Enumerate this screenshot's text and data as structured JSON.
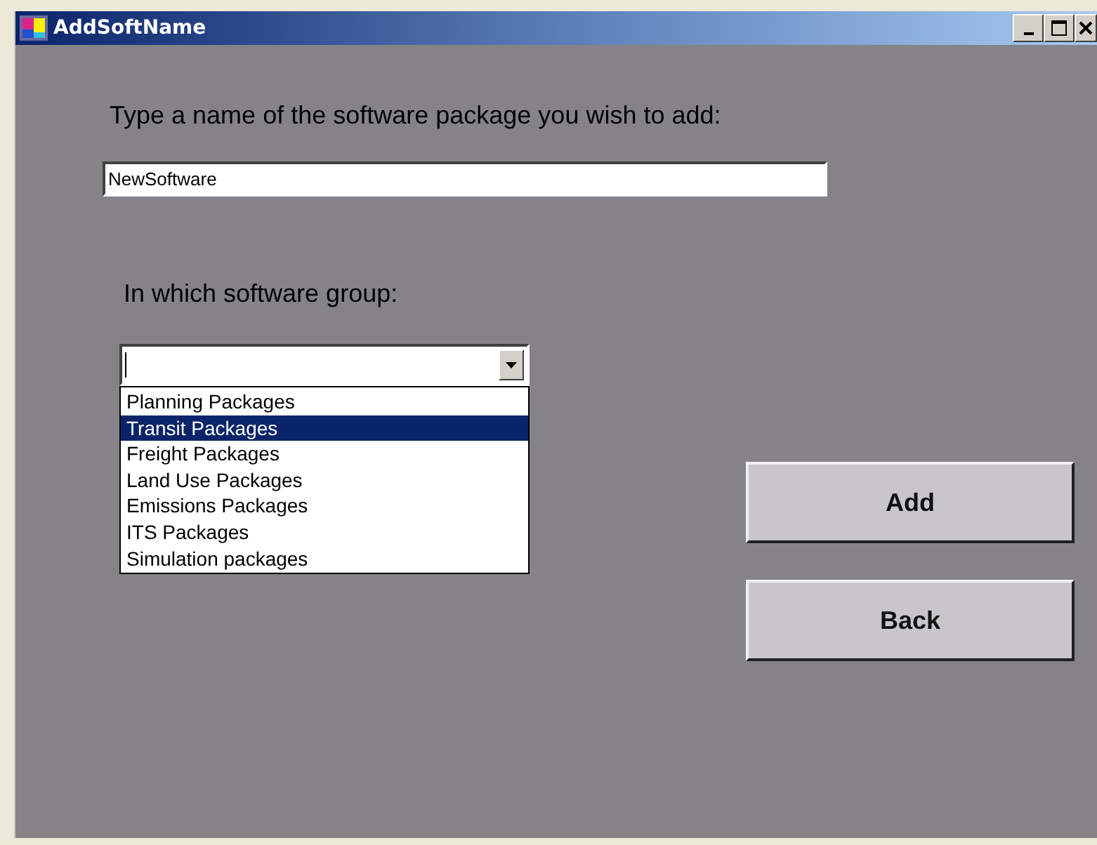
{
  "window": {
    "title": "AddSoftName"
  },
  "name_prompt": "Type a name of the software package you wish to add:",
  "name_field": {
    "value": "NewSoftware"
  },
  "group_prompt": "In which software group:",
  "group_combo": {
    "expanded": true,
    "options": [
      {
        "label": "Planning Packages",
        "selected": false
      },
      {
        "label": "Transit Packages",
        "selected": true
      },
      {
        "label": "Freight Packages",
        "selected": false
      },
      {
        "label": "Land Use Packages",
        "selected": false
      },
      {
        "label": "Emissions Packages",
        "selected": false
      },
      {
        "label": "ITS Packages",
        "selected": false
      },
      {
        "label": "Simulation packages",
        "selected": false
      }
    ]
  },
  "buttons": [
    "Add",
    "Back"
  ]
}
